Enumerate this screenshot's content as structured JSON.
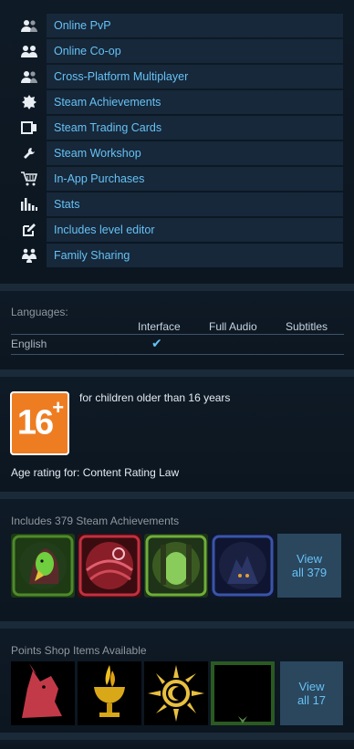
{
  "features": [
    {
      "label": "Online PvP",
      "icon": "users-icon"
    },
    {
      "label": "Online Co-op",
      "icon": "coop-icon"
    },
    {
      "label": "Cross-Platform Multiplayer",
      "icon": "users-icon"
    },
    {
      "label": "Steam Achievements",
      "icon": "achievement-icon"
    },
    {
      "label": "Steam Trading Cards",
      "icon": "cards-icon"
    },
    {
      "label": "Steam Workshop",
      "icon": "wrench-icon"
    },
    {
      "label": "In-App Purchases",
      "icon": "cart-icon"
    },
    {
      "label": "Stats",
      "icon": "stats-icon"
    },
    {
      "label": "Includes level editor",
      "icon": "editor-icon"
    },
    {
      "label": "Family Sharing",
      "icon": "family-icon"
    }
  ],
  "languages": {
    "title": "Languages:",
    "columns": [
      "Interface",
      "Full Audio",
      "Subtitles"
    ],
    "rows": [
      {
        "name": "English",
        "interface": true,
        "audio": false,
        "subtitles": false
      }
    ],
    "check_mark": "✔"
  },
  "rating": {
    "badge": "16",
    "badge_plus": "+",
    "description": "for children older than 16 years",
    "law": "Age rating for: Content Rating Law"
  },
  "achievements": {
    "title": "Includes 379 Steam Achievements",
    "view_label_1": "View",
    "view_label_2": "all 379"
  },
  "points_shop": {
    "title": "Points Shop Items Available",
    "view_label_1": "View",
    "view_label_2": "all 17"
  },
  "colors": {
    "link": "#67c1f5",
    "feature_bg": "#16283a",
    "rating_orange": "#ee7d22"
  }
}
